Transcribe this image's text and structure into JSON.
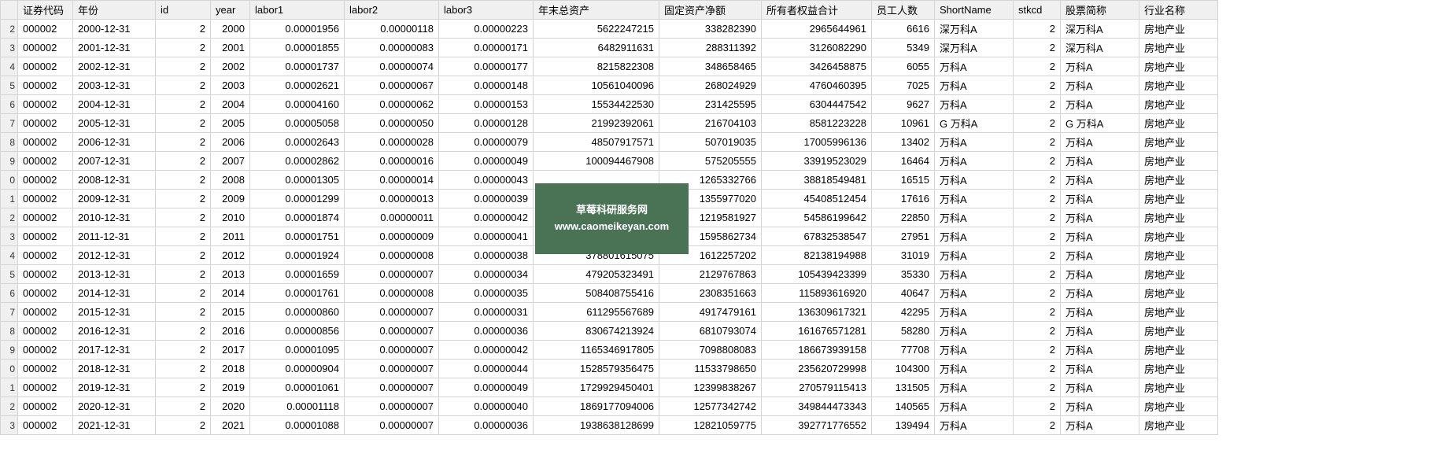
{
  "headers": [
    "证券代码",
    "年份",
    "id",
    "year",
    "labor1",
    "labor2",
    "labor3",
    "年末总资产",
    "固定资产净额",
    "所有者权益合计",
    "员工人数",
    "ShortName",
    "stkcd",
    "股票简称",
    "行业名称"
  ],
  "rowNumbers": [
    "2",
    "3",
    "4",
    "5",
    "6",
    "7",
    "8",
    "9",
    "0",
    "1",
    "2",
    "3",
    "4",
    "5",
    "6",
    "7",
    "8",
    "9",
    "0",
    "1",
    "2",
    "3"
  ],
  "rows": [
    [
      "000002",
      "2000-12-31",
      "2",
      "2000",
      "0.00001956",
      "0.00000118",
      "0.00000223",
      "5622247215",
      "338282390",
      "2965644961",
      "6616",
      "深万科A",
      "2",
      "深万科A",
      "房地产业"
    ],
    [
      "000002",
      "2001-12-31",
      "2",
      "2001",
      "0.00001855",
      "0.00000083",
      "0.00000171",
      "6482911631",
      "288311392",
      "3126082290",
      "5349",
      "深万科A",
      "2",
      "深万科A",
      "房地产业"
    ],
    [
      "000002",
      "2002-12-31",
      "2",
      "2002",
      "0.00001737",
      "0.00000074",
      "0.00000177",
      "8215822308",
      "348658465",
      "3426458875",
      "6055",
      "万科A",
      "2",
      "万科A",
      "房地产业"
    ],
    [
      "000002",
      "2003-12-31",
      "2",
      "2003",
      "0.00002621",
      "0.00000067",
      "0.00000148",
      "10561040096",
      "268024929",
      "4760460395",
      "7025",
      "万科A",
      "2",
      "万科A",
      "房地产业"
    ],
    [
      "000002",
      "2004-12-31",
      "2",
      "2004",
      "0.00004160",
      "0.00000062",
      "0.00000153",
      "15534422530",
      "231425595",
      "6304447542",
      "9627",
      "万科A",
      "2",
      "万科A",
      "房地产业"
    ],
    [
      "000002",
      "2005-12-31",
      "2",
      "2005",
      "0.00005058",
      "0.00000050",
      "0.00000128",
      "21992392061",
      "216704103",
      "8581223228",
      "10961",
      "G 万科A",
      "2",
      "G 万科A",
      "房地产业"
    ],
    [
      "000002",
      "2006-12-31",
      "2",
      "2006",
      "0.00002643",
      "0.00000028",
      "0.00000079",
      "48507917571",
      "507019035",
      "17005996136",
      "13402",
      "万科A",
      "2",
      "万科A",
      "房地产业"
    ],
    [
      "000002",
      "2007-12-31",
      "2",
      "2007",
      "0.00002862",
      "0.00000016",
      "0.00000049",
      "100094467908",
      "575205555",
      "33919523029",
      "16464",
      "万科A",
      "2",
      "万科A",
      "房地产业"
    ],
    [
      "000002",
      "2008-12-31",
      "2",
      "2008",
      "0.00001305",
      "0.00000014",
      "0.00000043",
      "",
      "1265332766",
      "38818549481",
      "16515",
      "万科A",
      "2",
      "万科A",
      "房地产业"
    ],
    [
      "000002",
      "2009-12-31",
      "2",
      "2009",
      "0.00001299",
      "0.00000013",
      "0.00000039",
      "",
      "1355977020",
      "45408512454",
      "17616",
      "万科A",
      "2",
      "万科A",
      "房地产业"
    ],
    [
      "000002",
      "2010-12-31",
      "2",
      "2010",
      "0.00001874",
      "0.00000011",
      "0.00000042",
      "",
      "1219581927",
      "54586199642",
      "22850",
      "万科A",
      "2",
      "万科A",
      "房地产业"
    ],
    [
      "000002",
      "2011-12-31",
      "2",
      "2011",
      "0.00001751",
      "0.00000009",
      "0.00000041",
      "",
      "1595862734",
      "67832538547",
      "27951",
      "万科A",
      "2",
      "万科A",
      "房地产业"
    ],
    [
      "000002",
      "2012-12-31",
      "2",
      "2012",
      "0.00001924",
      "0.00000008",
      "0.00000038",
      "378801615075",
      "1612257202",
      "82138194988",
      "31019",
      "万科A",
      "2",
      "万科A",
      "房地产业"
    ],
    [
      "000002",
      "2013-12-31",
      "2",
      "2013",
      "0.00001659",
      "0.00000007",
      "0.00000034",
      "479205323491",
      "2129767863",
      "105439423399",
      "35330",
      "万科A",
      "2",
      "万科A",
      "房地产业"
    ],
    [
      "000002",
      "2014-12-31",
      "2",
      "2014",
      "0.00001761",
      "0.00000008",
      "0.00000035",
      "508408755416",
      "2308351663",
      "115893616920",
      "40647",
      "万科A",
      "2",
      "万科A",
      "房地产业"
    ],
    [
      "000002",
      "2015-12-31",
      "2",
      "2015",
      "0.00000860",
      "0.00000007",
      "0.00000031",
      "611295567689",
      "4917479161",
      "136309617321",
      "42295",
      "万科A",
      "2",
      "万科A",
      "房地产业"
    ],
    [
      "000002",
      "2016-12-31",
      "2",
      "2016",
      "0.00000856",
      "0.00000007",
      "0.00000036",
      "830674213924",
      "6810793074",
      "161676571281",
      "58280",
      "万科A",
      "2",
      "万科A",
      "房地产业"
    ],
    [
      "000002",
      "2017-12-31",
      "2",
      "2017",
      "0.00001095",
      "0.00000007",
      "0.00000042",
      "1165346917805",
      "7098808083",
      "186673939158",
      "77708",
      "万科A",
      "2",
      "万科A",
      "房地产业"
    ],
    [
      "000002",
      "2018-12-31",
      "2",
      "2018",
      "0.00000904",
      "0.00000007",
      "0.00000044",
      "1528579356475",
      "11533798650",
      "235620729998",
      "104300",
      "万科A",
      "2",
      "万科A",
      "房地产业"
    ],
    [
      "000002",
      "2019-12-31",
      "2",
      "2019",
      "0.00001061",
      "0.00000007",
      "0.00000049",
      "1729929450401",
      "12399838267",
      "270579115413",
      "131505",
      "万科A",
      "2",
      "万科A",
      "房地产业"
    ],
    [
      "000002",
      "2020-12-31",
      "2",
      "2020",
      "0.00001118",
      "0.00000007",
      "0.00000040",
      "1869177094006",
      "12577342742",
      "349844473343",
      "140565",
      "万科A",
      "2",
      "万科A",
      "房地产业"
    ],
    [
      "000002",
      "2021-12-31",
      "2",
      "2021",
      "0.00001088",
      "0.00000007",
      "0.00000036",
      "1938638128699",
      "12821059775",
      "392771776552",
      "139494",
      "万科A",
      "2",
      "万科A",
      "房地产业"
    ]
  ],
  "watermark": {
    "title": "草莓科研服务网",
    "url": "www.caomeikeyan.com"
  },
  "colClasses": [
    "col-code",
    "col-date",
    "col-id",
    "col-year",
    "col-labor1",
    "col-labor2",
    "col-labor3",
    "col-assets",
    "col-fixed",
    "col-equity",
    "col-emp",
    "col-short",
    "col-stkcd",
    "col-name",
    "col-ind"
  ]
}
